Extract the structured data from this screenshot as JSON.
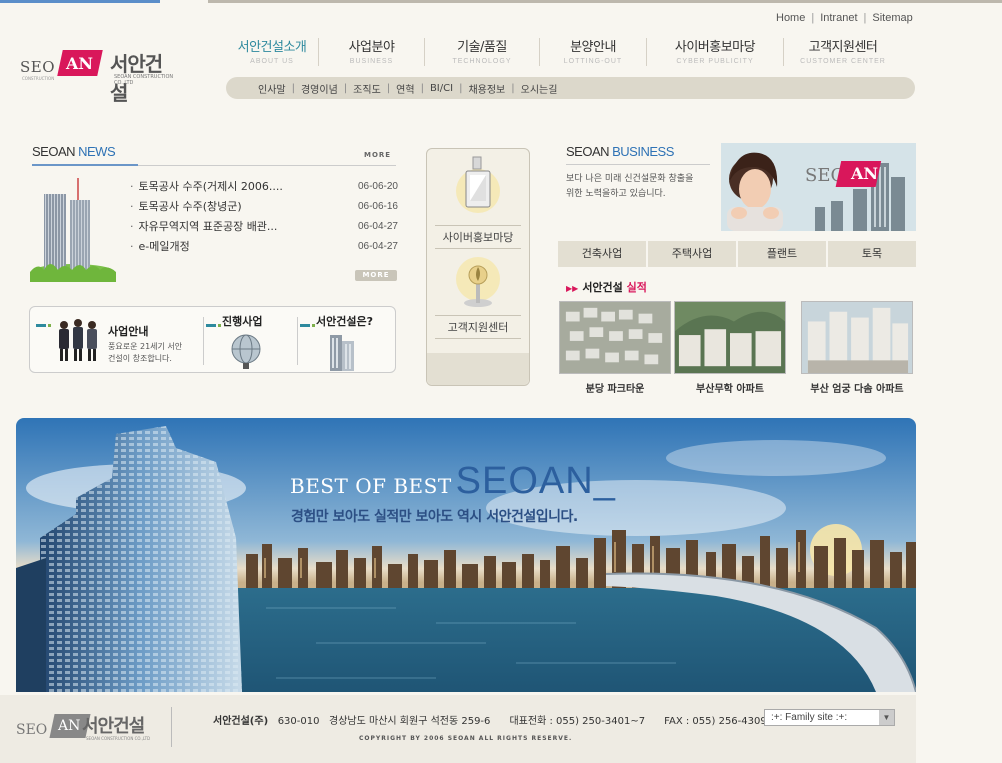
{
  "util_links": [
    "Home",
    "Intranet",
    "Sitemap"
  ],
  "logo": {
    "seo": "SEO",
    "an": "AN",
    "korean": "서안건설",
    "sub": "SEOAN CONSTRUCTION CO.,LTD",
    "csub": "CONSTRUCTION"
  },
  "nav": [
    {
      "ko": "서안건설소개",
      "en": "ABOUT US"
    },
    {
      "ko": "사업분야",
      "en": "BUSINESS"
    },
    {
      "ko": "기술/품질",
      "en": "TECHNOLOGY"
    },
    {
      "ko": "분양안내",
      "en": "LOTTING-OUT"
    },
    {
      "ko": "사이버홍보마당",
      "en": "CYBER PUBLICITY"
    },
    {
      "ko": "고객지원센터",
      "en": "CUSTOMER CENTER"
    }
  ],
  "subnav": [
    "인사말",
    "경영이념",
    "조직도",
    "연혁",
    "BI/CI",
    "채용정보",
    "오시는길"
  ],
  "news": {
    "title_a": "SEOAN",
    "title_b": " NEWS",
    "more": "MORE",
    "more_btn": "MORE",
    "items": [
      {
        "title": "토목공사 수주(거제시 2006....",
        "date": "06-06-20"
      },
      {
        "title": "토목공사 수주(창녕군)",
        "date": "06-06-16"
      },
      {
        "title": "자유무역지역 표준공장 배관...",
        "date": "06-04-27"
      },
      {
        "title": "e-메일개정",
        "date": "06-04-27"
      }
    ]
  },
  "info": {
    "b1_label": "사업안내",
    "b1_desc1": "풍요로운 21세기 서안",
    "b1_desc2": "건설이 창조합니다.",
    "b2_label": "진행사업",
    "b3_label": "서안건설은?"
  },
  "center": {
    "c1": "사이버홍보마당",
    "c2": "고객지원센터"
  },
  "business": {
    "title_a": "SEOAN",
    "title_b": " BUSINESS",
    "desc1": "보다 나은 미래 신건설문화 창출을",
    "desc2": "위한 노력을하고 있습니다.",
    "tabs": [
      "건축사업",
      "주택사업",
      "플랜트",
      "토목"
    ],
    "perf_title_a": "서안건설",
    "perf_title_b": "실적",
    "perf": [
      "분당 파크타운",
      "부산무학 아파트",
      "부산 엄궁 다솜 아파트"
    ]
  },
  "banner": {
    "line1": "BEST OF BEST",
    "line2": "SEOAN_",
    "sub": "경험만 보아도 실적만 보아도 역시 서안건설입니다."
  },
  "footer": {
    "company": "서안건설(주)",
    "zip": "630-010",
    "addr": "경상남도 마산시 회원구 석전동 259-6",
    "tel": "대표전화 : 055) 250-3401~7",
    "fax": "FAX : 055) 256-4309",
    "copyright": "COPYRIGHT BY 2006 SEOAN ALL RIGHTS RESERVE.",
    "family": ":+: Family site :+:"
  },
  "colors": {
    "accent": "#2e8a9e",
    "brand": "#d9175b",
    "blue": "#2e72b5"
  }
}
